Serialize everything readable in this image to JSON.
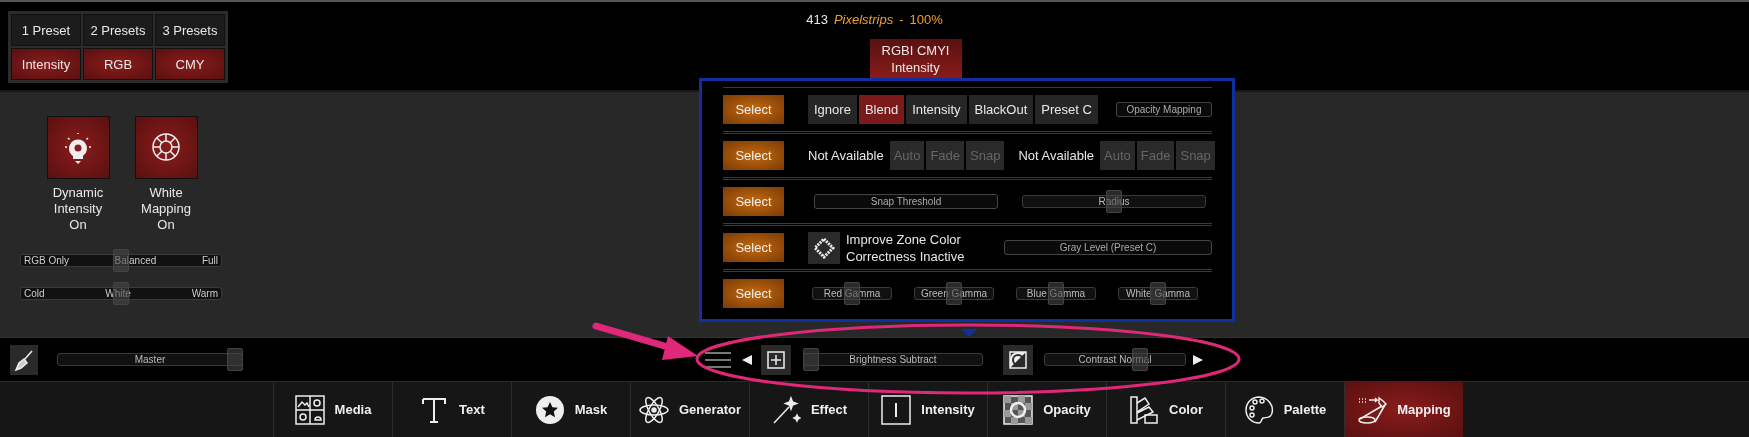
{
  "header": {
    "count": "413",
    "fixture": "Pixelstrips",
    "separator": "-",
    "percent": "100%"
  },
  "preset_grid": [
    {
      "kind": "count",
      "cells": [
        "1 Preset",
        "2 Presets",
        "3 Presets"
      ]
    },
    {
      "kind": "mode",
      "cells": [
        "Intensity",
        "RGB",
        "CMY"
      ]
    }
  ],
  "mode_tab": {
    "label": "RGBI CMYI Intensity",
    "selected": true
  },
  "toggles": [
    {
      "name": "Dynamic Intensity",
      "status": "On",
      "on": true
    },
    {
      "name": "White Mapping",
      "status": "On",
      "on": true
    }
  ],
  "left_sliders": [
    {
      "left": "RGB Only",
      "center": "Balanced",
      "right": "Full",
      "level": 0.5
    },
    {
      "left": "Cold",
      "center": "White",
      "right": "Warm",
      "level": 0.5
    }
  ],
  "popup_rows": [
    {
      "kind": "choice",
      "button": "Select",
      "options": [
        {
          "label": "Ignore",
          "selected": false
        },
        {
          "label": "Blend",
          "selected": true
        },
        {
          "label": "Intensity",
          "selected": false
        },
        {
          "label": "BlackOut",
          "selected": false
        },
        {
          "label": "Preset C",
          "selected": false
        }
      ],
      "field": "Opacity Mapping"
    },
    {
      "kind": "transition",
      "button": "Select",
      "groups": [
        {
          "status": "Not Available",
          "options": [
            {
              "label": "Auto",
              "disabled": true
            },
            {
              "label": "Fade",
              "disabled": true
            },
            {
              "label": "Snap",
              "disabled": true
            }
          ]
        },
        {
          "status": "Not Available",
          "options": [
            {
              "label": "Auto",
              "disabled": true
            },
            {
              "label": "Fade",
              "disabled": true
            },
            {
              "label": "Snap",
              "disabled": true
            }
          ]
        }
      ]
    },
    {
      "kind": "sliders",
      "button": "Select",
      "sliders": [
        {
          "label": "Snap Threshold"
        },
        {
          "label": "Radius",
          "level": 0.5
        }
      ]
    },
    {
      "kind": "toggle",
      "button": "Select",
      "text": "Improve Zone Color Correctness Inactive",
      "field": "Gray Level (Preset C)"
    },
    {
      "kind": "gamma",
      "button": "Select",
      "sliders": [
        {
          "label": "Red Gamma",
          "level": 0.5
        },
        {
          "label": "Green Gamma",
          "level": 0.5
        },
        {
          "label": "Blue Gamma",
          "level": 0.5
        },
        {
          "label": "White Gamma",
          "level": 0.5
        }
      ]
    }
  ],
  "control_bar": {
    "master": {
      "label": "Master",
      "level": 1
    },
    "brightness": {
      "label": "Brightness Subtract",
      "level": 0
    },
    "contrast": {
      "label": "Contrast Normal",
      "level": 0.7
    }
  },
  "tabs": [
    {
      "label": "Media",
      "selected": false
    },
    {
      "label": "Text",
      "selected": false
    },
    {
      "label": "Mask",
      "selected": false
    },
    {
      "label": "Generator",
      "selected": false
    },
    {
      "label": "Effect",
      "selected": false
    },
    {
      "label": "Intensity",
      "selected": false
    },
    {
      "label": "Opacity",
      "selected": false
    },
    {
      "label": "Color",
      "selected": false
    },
    {
      "label": "Palette",
      "selected": false
    },
    {
      "label": "Mapping",
      "selected": true
    }
  ]
}
